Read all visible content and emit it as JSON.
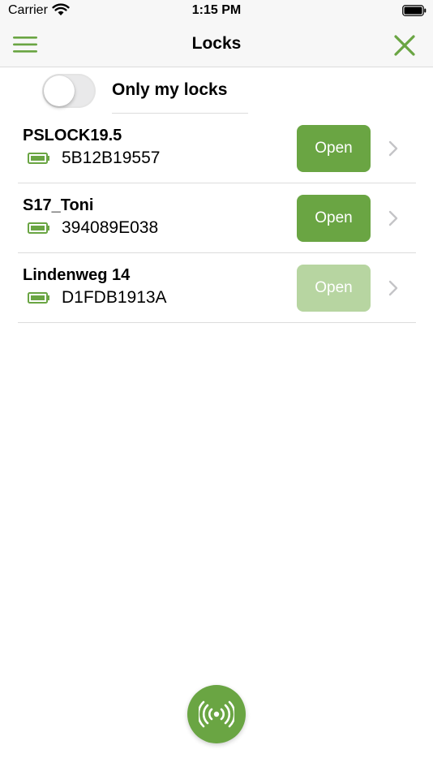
{
  "status_bar": {
    "carrier": "Carrier",
    "time": "1:15 PM"
  },
  "nav": {
    "title": "Locks",
    "menu_icon": "hamburger-menu-icon",
    "close_icon": "close-x-icon"
  },
  "filter": {
    "label": "Only my locks",
    "enabled": false
  },
  "locks": [
    {
      "name": "PSLOCK19.5",
      "id": "5B12B19557",
      "open_label": "Open",
      "open_enabled": true,
      "battery": "full"
    },
    {
      "name": "S17_Toni",
      "id": "394089E038",
      "open_label": "Open",
      "open_enabled": true,
      "battery": "full"
    },
    {
      "name": "Lindenweg 14",
      "id": "D1FDB1913A",
      "open_label": "Open",
      "open_enabled": false,
      "battery": "full"
    }
  ],
  "scan_button": {
    "icon": "radio-waves-icon"
  },
  "colors": {
    "accent": "#6aa543",
    "accent_disabled": "#b7d5a1",
    "battery": "#6aa543"
  }
}
